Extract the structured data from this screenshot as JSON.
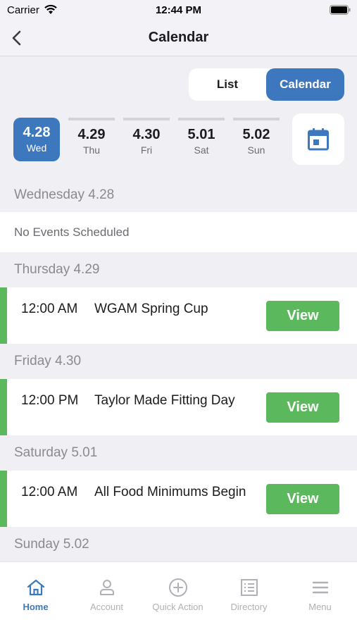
{
  "status_bar": {
    "carrier": "Carrier",
    "time": "12:44 PM"
  },
  "nav": {
    "title": "Calendar",
    "back_icon": "chevron-left-icon"
  },
  "view_toggle": {
    "options": [
      "List",
      "Calendar"
    ],
    "selected": "Calendar"
  },
  "date_strip": {
    "days": [
      {
        "date": "4.28",
        "dow": "Wed",
        "selected": true
      },
      {
        "date": "4.29",
        "dow": "Thu",
        "selected": false
      },
      {
        "date": "4.30",
        "dow": "Fri",
        "selected": false
      },
      {
        "date": "5.01",
        "dow": "Sat",
        "selected": false
      },
      {
        "date": "5.02",
        "dow": "Sun",
        "selected": false
      }
    ],
    "picker_icon": "calendar-icon"
  },
  "sections": [
    {
      "header": "Wednesday 4.28",
      "empty_text": "No Events Scheduled",
      "events": []
    },
    {
      "header": "Thursday 4.29",
      "events": [
        {
          "time": "12:00 AM",
          "title": "WGAM Spring Cup",
          "action": "View"
        }
      ]
    },
    {
      "header": "Friday 4.30",
      "events": [
        {
          "time": "12:00 PM",
          "title": "Taylor Made Fitting Day",
          "action": "View"
        }
      ]
    },
    {
      "header": "Saturday 5.01",
      "events": [
        {
          "time": "12:00 AM",
          "title": "All Food Minimums Begin",
          "action": "View"
        }
      ]
    },
    {
      "header": "Sunday 5.02",
      "events": []
    }
  ],
  "tab_bar": {
    "items": [
      {
        "label": "Home",
        "icon": "home-icon",
        "active": true
      },
      {
        "label": "Account",
        "icon": "person-icon",
        "active": false
      },
      {
        "label": "Quick Action",
        "icon": "plus-circle-icon",
        "active": false
      },
      {
        "label": "Directory",
        "icon": "directory-icon",
        "active": false
      },
      {
        "label": "Menu",
        "icon": "menu-icon",
        "active": false
      }
    ]
  },
  "colors": {
    "accent": "#3d78be",
    "event_green": "#5cb85c",
    "tab_inactive": "#b0b0b6"
  }
}
